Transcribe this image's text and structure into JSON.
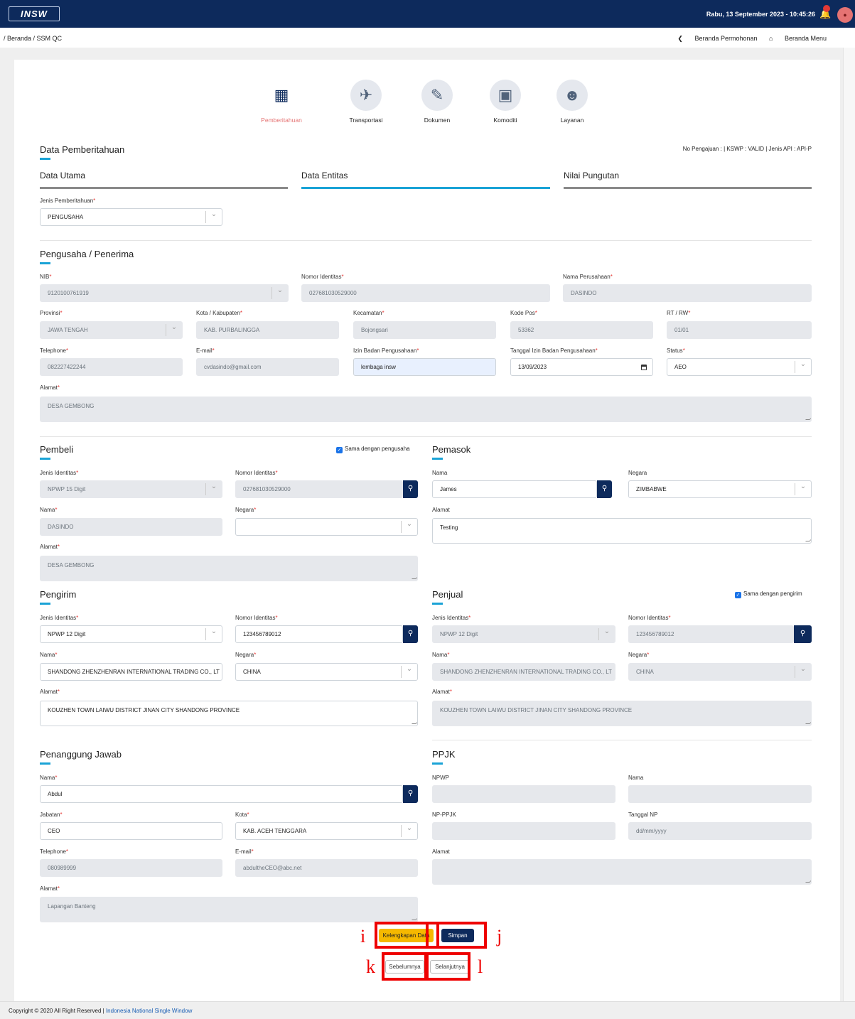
{
  "header": {
    "logo_text": "INSW",
    "datetime": "Rabu, 13 September 2023 - 10:45:26"
  },
  "breadcrumb": "/ Beranda / SSM QC",
  "nav": {
    "beranda_permohonan": "Beranda Permohonan",
    "beranda_menu": "Beranda Menu"
  },
  "steps": [
    {
      "label": "Pemberitahuan",
      "icon": "building-icon"
    },
    {
      "label": "Transportasi",
      "icon": "airplane-icon"
    },
    {
      "label": "Dokumen",
      "icon": "document-icon"
    },
    {
      "label": "Komoditi",
      "icon": "boxes-icon"
    },
    {
      "label": "Layanan",
      "icon": "customer-service-icon"
    }
  ],
  "page": {
    "title": "Data Pemberitahuan",
    "info": "No Pengajuan : | KSWP : VALID | Jenis API : API-P"
  },
  "tabs": [
    "Data Utama",
    "Data Entitas",
    "Nilai Pungutan"
  ],
  "jenis_pemberitahuan": {
    "label": "Jenis Pemberitahuan",
    "value": "PENGUSAHA"
  },
  "pengusaha": {
    "title": "Pengusaha / Penerima",
    "nib": {
      "label": "NIB",
      "value": "9120100761919"
    },
    "nomor_identitas": {
      "label": "Nomor Identitas",
      "value": "027681030529000"
    },
    "nama_perusahaan": {
      "label": "Nama Perusahaan",
      "value": "DASINDO"
    },
    "provinsi": {
      "label": "Provinsi",
      "value": "JAWA TENGAH"
    },
    "kota": {
      "label": "Kota / Kabupaten",
      "value": "KAB. PURBALINGGA"
    },
    "kecamatan": {
      "label": "Kecamatan",
      "value": "Bojongsari"
    },
    "kode_pos": {
      "label": "Kode Pos",
      "value": "53362"
    },
    "rt_rw": {
      "label": "RT / RW",
      "value": "01/01"
    },
    "telephone": {
      "label": "Telephone",
      "value": "082227422244"
    },
    "email": {
      "label": "E-mail",
      "value": "cvdasindo@gmail.com"
    },
    "izin": {
      "label": "Izin Badan Pengusahaan",
      "value": "lembaga insw"
    },
    "tanggal_izin": {
      "label": "Tanggal Izin Badan Pengusahaan",
      "value": "13/09/2023"
    },
    "status": {
      "label": "Status",
      "value": "AEO"
    },
    "alamat": {
      "label": "Alamat",
      "value": "DESA GEMBONG"
    }
  },
  "pembeli": {
    "title": "Pembeli",
    "same_label": "Sama dengan pengusaha",
    "jenis_identitas": {
      "label": "Jenis Identitas",
      "value": "NPWP 15 Digit"
    },
    "nomor_identitas": {
      "label": "Nomor Identitas",
      "value": "027681030529000"
    },
    "nama": {
      "label": "Nama",
      "value": "DASINDO"
    },
    "negara": {
      "label": "Negara",
      "value": ""
    },
    "alamat": {
      "label": "Alamat",
      "value": "DESA GEMBONG"
    }
  },
  "pemasok": {
    "title": "Pemasok",
    "nama": {
      "label": "Nama",
      "value": "James"
    },
    "negara": {
      "label": "Negara",
      "value": "ZIMBABWE"
    },
    "alamat": {
      "label": "Alamat",
      "value": "Testing"
    }
  },
  "pengirim": {
    "title": "Pengirim",
    "jenis_identitas": {
      "label": "Jenis Identitas",
      "value": "NPWP 12 Digit"
    },
    "nomor_identitas": {
      "label": "Nomor Identitas",
      "value": "123456789012"
    },
    "nama": {
      "label": "Nama",
      "value": "SHANDONG ZHENZHENRAN INTERNATIONAL TRADING CO., LT"
    },
    "negara": {
      "label": "Negara",
      "value": "CHINA"
    },
    "alamat": {
      "label": "Alamat",
      "value": "KOUZHEN TOWN LAIWU DISTRICT JINAN CITY SHANDONG PROVINCE"
    }
  },
  "penjual": {
    "title": "Penjual",
    "same_label": "Sama dengan pengirim",
    "jenis_identitas": {
      "label": "Jenis Identitas",
      "value": "NPWP 12 Digit"
    },
    "nomor_identitas": {
      "label": "Nomor Identitas",
      "value": "123456789012"
    },
    "nama": {
      "label": "Nama",
      "value": "SHANDONG ZHENZHENRAN INTERNATIONAL TRADING CO., LT"
    },
    "negara": {
      "label": "Negara",
      "value": "CHINA"
    },
    "alamat": {
      "label": "Alamat",
      "value": "KOUZHEN TOWN LAIWU DISTRICT JINAN CITY SHANDONG PROVINCE"
    }
  },
  "penanggung": {
    "title": "Penanggung Jawab",
    "nama": {
      "label": "Nama",
      "value": "Abdul"
    },
    "jabatan": {
      "label": "Jabatan",
      "value": "CEO"
    },
    "kota": {
      "label": "Kota",
      "value": "KAB. ACEH TENGGARA"
    },
    "telephone": {
      "label": "Telephone",
      "value": "080989999"
    },
    "email": {
      "label": "E-mail",
      "value": "abdultheCEO@abc.net"
    },
    "alamat": {
      "label": "Alamat",
      "value": "Lapangan Banteng"
    }
  },
  "ppjk": {
    "title": "PPJK",
    "npwp": {
      "label": "NPWP",
      "value": ""
    },
    "nama": {
      "label": "Nama",
      "value": ""
    },
    "np_ppjk": {
      "label": "NP-PPJK",
      "value": ""
    },
    "tanggal_np": {
      "label": "Tanggal NP",
      "value": "dd/mm/yyyy"
    },
    "alamat": {
      "label": "Alamat",
      "value": ""
    }
  },
  "buttons": {
    "kelengkapan": "Kelengkapan Data",
    "simpan": "Simpan",
    "sebelumnya": "Sebelumnya",
    "selanjutnya": "Selanjutnya"
  },
  "annotations": {
    "i": "i",
    "j": "j",
    "k": "k",
    "l": "l"
  },
  "footer": {
    "copyright": "Copyright © 2020 All Right Reserved |",
    "link": "Indonesia National Single Window"
  }
}
